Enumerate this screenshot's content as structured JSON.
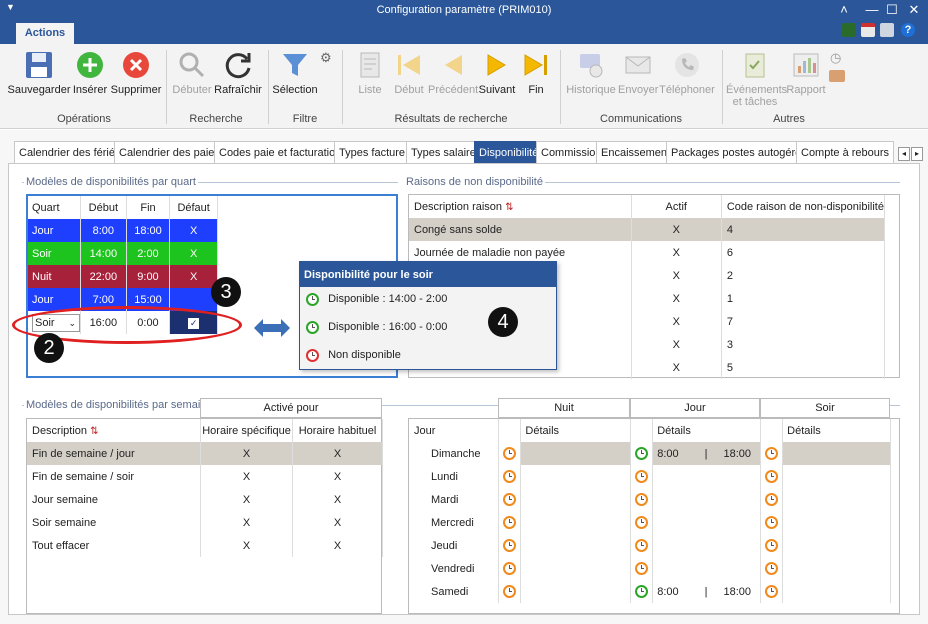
{
  "window": {
    "title": "Configuration paramètre (PRIM010)"
  },
  "ribbon": {
    "tab": "Actions",
    "groups": [
      {
        "label": "Opérations"
      },
      {
        "label": "Recherche"
      },
      {
        "label": "Filtre"
      },
      {
        "label": "Résultats de recherche"
      },
      {
        "label": "Communications"
      },
      {
        "label": "Autres"
      }
    ],
    "buttons": {
      "save": "Sauvegarder",
      "insert": "Insérer",
      "delete": "Supprimer",
      "start": "Débuter",
      "refresh": "Rafraîchir",
      "selection": "Sélection",
      "list": "Liste",
      "first": "Début",
      "previous": "Précédent",
      "next": "Suivant",
      "last": "Fin",
      "history": "Historique",
      "send": "Envoyer",
      "phone": "Téléphoner",
      "events_l1": "Événements",
      "events_l2": "et tâches",
      "report": "Rapport"
    }
  },
  "tabs": [
    "Calendrier des fériés",
    "Calendrier des paies",
    "Codes paie et facturation",
    "Types facture",
    "Types salaire",
    "Disponibilité",
    "Commission",
    "Encaissement",
    "Packages postes autogérés",
    "Compte à rebours"
  ],
  "shift_panel": {
    "title": "Modèles de disponibilités par quart",
    "headers": [
      "Quart",
      "Début",
      "Fin",
      "Défaut"
    ],
    "rows": [
      {
        "quart": "Jour",
        "debut": "8:00",
        "fin": "18:00",
        "defaut": "X"
      },
      {
        "quart": "Soir",
        "debut": "14:00",
        "fin": "2:00",
        "defaut": "X"
      },
      {
        "quart": "Nuit",
        "debut": "22:00",
        "fin": "9:00",
        "defaut": "X"
      },
      {
        "quart": "Jour",
        "debut": "7:00",
        "fin": "15:00",
        "defaut": ""
      }
    ],
    "edit_row": {
      "quart": "Soir",
      "debut": "16:00",
      "fin": "0:00"
    }
  },
  "reasons_panel": {
    "title": "Raisons de non disponibilité",
    "headers": [
      "Description raison",
      "Actif",
      "Code raison de non-disponibilité"
    ],
    "rows": [
      {
        "desc": "Congé sans solde",
        "actif": "X",
        "code": "4"
      },
      {
        "desc": "Journée de maladie non payée",
        "actif": "X",
        "code": "6"
      },
      {
        "desc": "",
        "actif": "X",
        "code": "2"
      },
      {
        "desc": "",
        "actif": "X",
        "code": "1"
      },
      {
        "desc": "",
        "actif": "X",
        "code": "7"
      },
      {
        "desc": "",
        "actif": "X",
        "code": "3"
      },
      {
        "desc": "",
        "actif": "X",
        "code": "5"
      }
    ]
  },
  "popup": {
    "title": "Disponibilité pour le soir",
    "items": [
      "Disponible :  14:00 - 2:00",
      "Disponible :  16:00 - 0:00",
      "Non disponible"
    ]
  },
  "badges": [
    "2",
    "3",
    "4"
  ],
  "week_panel": {
    "title": "Modèles de disponibilités par semaine",
    "group_header": "Activé pour",
    "headers": [
      "Description",
      "Horaire spécifique",
      "Horaire habituel"
    ],
    "rows": [
      {
        "desc": "Fin de semaine / jour",
        "spec": "X",
        "hab": "X"
      },
      {
        "desc": "Fin de semaine / soir",
        "spec": "X",
        "hab": "X"
      },
      {
        "desc": "Jour semaine",
        "spec": "X",
        "hab": "X"
      },
      {
        "desc": "Soir semaine",
        "spec": "X",
        "hab": "X"
      },
      {
        "desc": "Tout effacer",
        "spec": "X",
        "hab": "X"
      }
    ]
  },
  "days_panel": {
    "group_headers": [
      "Nuit",
      "Jour",
      "Soir"
    ],
    "headers": {
      "jour": "Jour",
      "details": "Détails"
    },
    "days": [
      "Dimanche",
      "Lundi",
      "Mardi",
      "Mercredi",
      "Jeudi",
      "Vendredi",
      "Samedi"
    ],
    "jour_details": {
      "Dimanche": {
        "start": "8:00",
        "sep": "|",
        "end": "18:00"
      },
      "Samedi": {
        "start": "8:00",
        "sep": "|",
        "end": "18:00"
      }
    }
  },
  "colors": {
    "blue": "#2b579a",
    "shift_blue": "#1f3fff",
    "shift_green": "#1ec41e",
    "shift_red": "#a8213a",
    "selected_tab": "#2b579a"
  }
}
